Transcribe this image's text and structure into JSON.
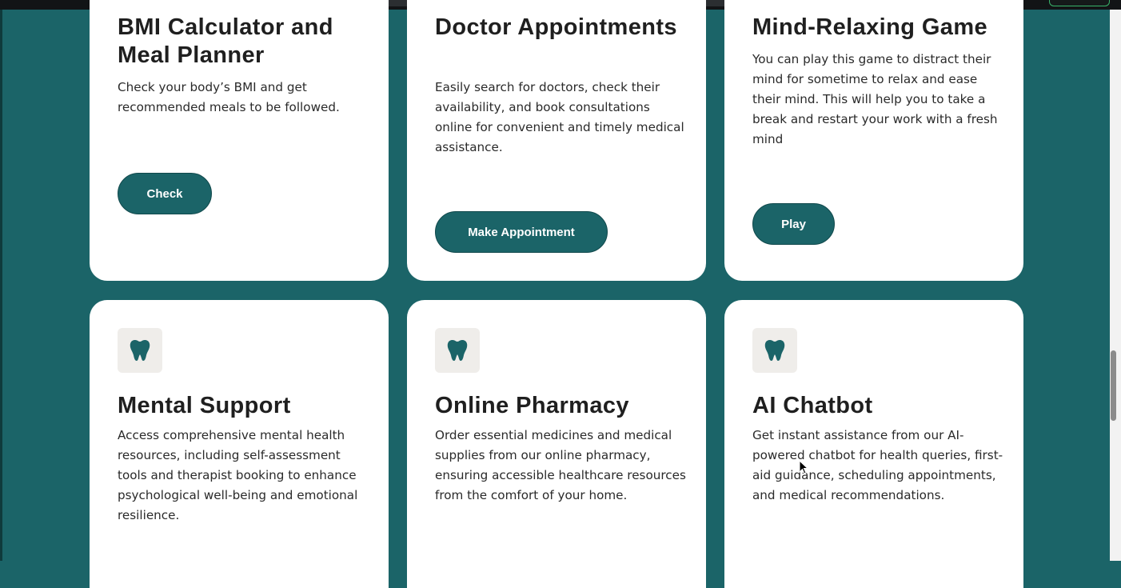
{
  "colors": {
    "background": "#1b6468",
    "card": "#ffffff",
    "button": "#1b6468",
    "icon_bg": "#efedea",
    "text": "#1f1f1f"
  },
  "cards_top": [
    {
      "title": "BMI Calculator and Meal Planner",
      "description": "Check your body’s BMI and get recommended meals to be followed.",
      "button": "Check"
    },
    {
      "title": "Doctor Appointments",
      "description": "Easily search for doctors, check their availability, and book consultations online for convenient and timely medical assistance.",
      "button": "Make Appointment"
    },
    {
      "title": "Mind-Relaxing Game",
      "description": "You can play this game to distract their mind for sometime to relax and ease their mind. This will help you to take a break and restart your work with a fresh mind",
      "button": "Play"
    }
  ],
  "cards_bottom": [
    {
      "icon": "tooth-icon",
      "title": "Mental Support",
      "description": "Access comprehensive mental health resources, including self-assessment tools and therapist booking to enhance psychological well-being and emotional resilience."
    },
    {
      "icon": "tooth-icon",
      "title": "Online Pharmacy",
      "description": "Order essential medicines and medical supplies from our online pharmacy, ensuring accessible healthcare resources from the comfort of your home."
    },
    {
      "icon": "tooth-icon",
      "title": "AI Chatbot",
      "description": "Get instant assistance from our AI-powered chatbot for health queries, first-aid guidance, scheduling appointments, and medical recommendations."
    }
  ]
}
